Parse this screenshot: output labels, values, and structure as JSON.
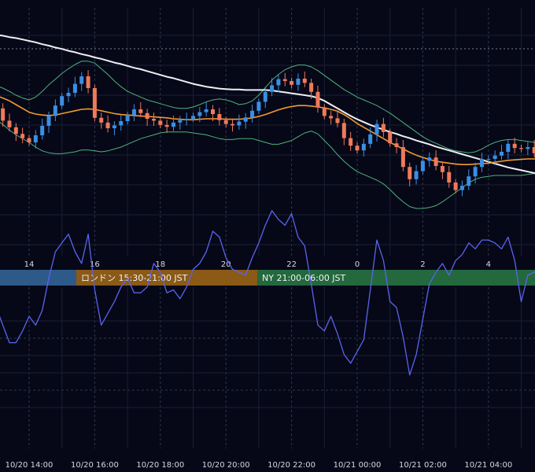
{
  "colors": {
    "background": "#060818",
    "grid": "#1a1f33",
    "grid_dashed": "#303650",
    "axis_text": "#d6d8e0",
    "candle_up": "#3b8fe3",
    "candle_down": "#ef7a5a",
    "ma_slow": "#eef0f4",
    "ma_fast": "#f29a2e",
    "bollinger": "#4fb27a",
    "oscillator": "#5a63ee",
    "session_tokyo": "#2e5a8a",
    "session_london": "#8a5a16",
    "session_ny": "#24683e"
  },
  "sessions": [
    {
      "label": "",
      "color": "#2e5a8a"
    },
    {
      "label": "ロンドン 15:30-21:00 JST",
      "color": "#8a5a16"
    },
    {
      "label": "NY 21:00-06:00 JST",
      "color": "#24683e"
    }
  ],
  "chart_data": [
    {
      "type": "candlestick",
      "x_tick_labels": [
        "14",
        "16",
        "18",
        "20",
        "22",
        "0",
        "2",
        "4"
      ],
      "x": [
        -2.0,
        -1.8,
        -1.6,
        -1.4,
        -1.2,
        -1.0,
        -0.8,
        -0.6,
        -0.4,
        -0.2,
        0.0,
        0.2,
        0.4,
        0.6,
        0.8,
        1.0,
        1.2,
        1.4,
        1.6,
        1.8,
        2.0,
        2.2,
        2.4,
        2.6,
        2.8,
        3.0,
        3.2,
        3.4,
        3.6,
        3.8,
        4.0,
        4.2,
        4.4,
        4.6,
        4.8,
        5.0,
        5.2,
        5.4,
        5.6,
        5.8,
        6.0,
        6.2,
        6.4,
        6.6,
        6.8,
        7.0,
        7.2,
        7.4,
        7.6,
        7.8,
        8.0,
        8.2,
        8.4,
        8.6,
        8.8,
        9.0,
        9.2,
        9.4,
        9.6,
        9.8,
        10.0,
        10.2,
        10.4,
        10.6,
        10.8,
        11.0,
        11.2,
        11.4,
        11.6,
        11.8,
        12.0,
        12.2,
        12.4,
        12.6,
        12.8,
        13.0,
        13.2,
        13.4,
        13.6,
        13.8,
        14.0,
        14.2,
        14.4,
        14.6,
        14.8,
        15.0,
        15.2,
        15.4,
        15.6,
        15.8,
        16.0,
        16.2,
        16.4,
        16.6,
        16.8,
        17.0,
        17.2,
        17.4,
        17.6,
        17.8,
        18.0
      ],
      "close": [
        1.62,
        1.58,
        1.35,
        1.48,
        1.3,
        1.12,
        0.86,
        0.72,
        0.58,
        0.49,
        0.4,
        0.55,
        0.75,
        0.96,
        1.18,
        1.38,
        1.45,
        1.64,
        1.8,
        1.55,
        0.92,
        0.82,
        0.7,
        0.76,
        0.85,
        0.98,
        1.1,
        1.02,
        0.9,
        0.86,
        0.77,
        0.73,
        0.82,
        0.87,
        0.9,
        0.96,
        1.04,
        1.1,
        1.0,
        0.87,
        0.79,
        0.76,
        0.84,
        0.93,
        1.07,
        1.26,
        1.47,
        1.61,
        1.74,
        1.7,
        1.62,
        1.75,
        1.66,
        1.47,
        1.14,
        0.96,
        0.91,
        0.81,
        0.49,
        0.33,
        0.23,
        0.37,
        0.57,
        0.79,
        0.62,
        0.38,
        0.3,
        -0.12,
        -0.38,
        -0.21,
        0.01,
        0.08,
        -0.1,
        -0.23,
        -0.45,
        -0.61,
        -0.52,
        -0.32,
        -0.12,
        0.05,
        0.05,
        0.12,
        0.2,
        0.37,
        0.28,
        0.26,
        0.3,
        0.17,
        0.1,
        0.11,
        0.17,
        0.12,
        0.12,
        0.05,
        0.04,
        0.02,
        -0.07,
        0.09,
        -0.24,
        -0.13,
        0.04
      ],
      "ma_fast": [
        1.5,
        1.48,
        1.46,
        1.44,
        1.42,
        1.39,
        1.34,
        1.28,
        1.2,
        1.12,
        1.04,
        1.0,
        0.98,
        0.97,
        0.98,
        1.01,
        1.04,
        1.07,
        1.1,
        1.11,
        1.1,
        1.07,
        1.04,
        1.01,
        0.99,
        0.98,
        0.97,
        0.96,
        0.95,
        0.94,
        0.93,
        0.92,
        0.9,
        0.89,
        0.88,
        0.88,
        0.89,
        0.9,
        0.9,
        0.9,
        0.89,
        0.89,
        0.89,
        0.9,
        0.92,
        0.95,
        0.99,
        1.04,
        1.09,
        1.13,
        1.16,
        1.18,
        1.18,
        1.17,
        1.15,
        1.13,
        1.1,
        1.06,
        0.99,
        0.9,
        0.8,
        0.72,
        0.64,
        0.56,
        0.48,
        0.4,
        0.33,
        0.26,
        0.19,
        0.13,
        0.08,
        0.04,
        0.0,
        -0.02,
        -0.04,
        -0.06,
        -0.07,
        -0.07,
        -0.06,
        -0.05,
        -0.04,
        -0.02,
        0.0,
        0.02,
        0.03,
        0.04,
        0.05,
        0.05,
        0.05,
        0.05,
        0.05,
        0.05,
        0.05,
        0.05,
        0.04,
        0.04,
        0.03,
        0.03,
        0.02,
        0.02,
        0.02
      ],
      "ma_slow": [
        2.78,
        2.76,
        2.74,
        2.72,
        2.7,
        2.68,
        2.66,
        2.63,
        2.61,
        2.58,
        2.55,
        2.52,
        2.48,
        2.45,
        2.41,
        2.38,
        2.34,
        2.31,
        2.27,
        2.24,
        2.2,
        2.17,
        2.13,
        2.09,
        2.06,
        2.02,
        1.98,
        1.95,
        1.91,
        1.87,
        1.83,
        1.79,
        1.76,
        1.72,
        1.68,
        1.64,
        1.61,
        1.58,
        1.56,
        1.54,
        1.53,
        1.52,
        1.52,
        1.51,
        1.51,
        1.51,
        1.51,
        1.5,
        1.48,
        1.46,
        1.44,
        1.42,
        1.4,
        1.38,
        1.34,
        1.28,
        1.2,
        1.12,
        1.04,
        0.96,
        0.89,
        0.83,
        0.77,
        0.72,
        0.67,
        0.62,
        0.58,
        0.53,
        0.49,
        0.44,
        0.4,
        0.36,
        0.31,
        0.27,
        0.23,
        0.19,
        0.15,
        0.11,
        0.07,
        0.03,
        -0.01,
        -0.05,
        -0.09,
        -0.13,
        -0.16,
        -0.19,
        -0.22,
        -0.25,
        -0.28,
        -0.31,
        -0.33,
        -0.36,
        -0.38,
        -0.4,
        -0.43,
        -0.46,
        -0.48,
        -0.51,
        -0.54,
        -0.57,
        -0.6
      ],
      "bollinger_upper": [
        1.82,
        1.78,
        1.74,
        1.7,
        1.66,
        1.6,
        1.55,
        1.48,
        1.4,
        1.34,
        1.3,
        1.36,
        1.48,
        1.62,
        1.74,
        1.86,
        1.96,
        2.05,
        2.12,
        2.12,
        2.08,
        1.96,
        1.84,
        1.7,
        1.58,
        1.48,
        1.42,
        1.36,
        1.3,
        1.26,
        1.22,
        1.18,
        1.14,
        1.12,
        1.12,
        1.15,
        1.2,
        1.26,
        1.3,
        1.32,
        1.3,
        1.26,
        1.2,
        1.22,
        1.28,
        1.4,
        1.56,
        1.72,
        1.84,
        1.94,
        2.0,
        2.04,
        2.04,
        2.0,
        1.92,
        1.82,
        1.72,
        1.62,
        1.52,
        1.44,
        1.36,
        1.3,
        1.24,
        1.18,
        1.1,
        1.02,
        0.92,
        0.82,
        0.72,
        0.62,
        0.52,
        0.44,
        0.38,
        0.32,
        0.26,
        0.22,
        0.2,
        0.18,
        0.2,
        0.26,
        0.34,
        0.4,
        0.44,
        0.46,
        0.46,
        0.44,
        0.42,
        0.4,
        0.38,
        0.36,
        0.34,
        0.3,
        0.26,
        0.24,
        0.22,
        0.22,
        0.22,
        0.24,
        0.24,
        0.24,
        0.24
      ],
      "bollinger_lower": [
        1.26,
        1.22,
        1.16,
        1.08,
        0.98,
        0.88,
        0.78,
        0.66,
        0.56,
        0.48,
        0.4,
        0.3,
        0.22,
        0.18,
        0.16,
        0.16,
        0.18,
        0.2,
        0.24,
        0.24,
        0.22,
        0.2,
        0.22,
        0.26,
        0.3,
        0.36,
        0.42,
        0.48,
        0.52,
        0.56,
        0.6,
        0.62,
        0.62,
        0.62,
        0.62,
        0.6,
        0.58,
        0.56,
        0.52,
        0.48,
        0.46,
        0.46,
        0.48,
        0.48,
        0.48,
        0.44,
        0.4,
        0.36,
        0.36,
        0.4,
        0.44,
        0.52,
        0.6,
        0.64,
        0.58,
        0.44,
        0.3,
        0.14,
        0.0,
        -0.12,
        -0.22,
        -0.28,
        -0.34,
        -0.4,
        -0.48,
        -0.6,
        -0.74,
        -0.86,
        -0.96,
        -1.0,
        -1.0,
        -0.98,
        -0.94,
        -0.86,
        -0.76,
        -0.66,
        -0.56,
        -0.46,
        -0.38,
        -0.34,
        -0.32,
        -0.3,
        -0.3,
        -0.3,
        -0.3,
        -0.3,
        -0.28,
        -0.26,
        -0.24,
        -0.22,
        -0.2,
        -0.2,
        -0.2,
        -0.18,
        -0.16,
        -0.14,
        -0.14,
        -0.14,
        -0.14,
        -0.14,
        -0.14
      ]
    },
    {
      "type": "line",
      "x_tick_labels": [
        "10/20 14:00",
        "10/20 16:00",
        "10/20 18:00",
        "10/20 20:00",
        "10/20 22:00",
        "10/21 00:00",
        "10/21 02:00",
        "10/21 04:00"
      ],
      "x": [
        -2.0,
        -1.8,
        -1.6,
        -1.4,
        -1.2,
        -1.0,
        -0.8,
        -0.6,
        -0.4,
        -0.2,
        0.0,
        0.2,
        0.4,
        0.6,
        0.8,
        1.0,
        1.2,
        1.4,
        1.6,
        1.8,
        2.0,
        2.2,
        2.4,
        2.6,
        2.8,
        3.0,
        3.2,
        3.4,
        3.6,
        3.8,
        4.0,
        4.2,
        4.4,
        4.6,
        4.8,
        5.0,
        5.2,
        5.4,
        5.6,
        5.8,
        6.0,
        6.2,
        6.4,
        6.6,
        6.8,
        7.0,
        7.2,
        7.4,
        7.6,
        7.8,
        8.0,
        8.2,
        8.4,
        8.6,
        8.8,
        9.0,
        9.2,
        9.4,
        9.6,
        9.8,
        10.0,
        10.2,
        10.4,
        10.6,
        10.8,
        11.0,
        11.2,
        11.4,
        11.6,
        11.8,
        12.0,
        12.2,
        12.4,
        12.6,
        12.8,
        13.0,
        13.2,
        13.4,
        13.6,
        13.8,
        14.0,
        14.2,
        14.4,
        14.6,
        14.8,
        15.0,
        15.2,
        15.4,
        15.6,
        15.8,
        16.0,
        16.2,
        16.4,
        16.6,
        16.8,
        17.0,
        17.2,
        17.4,
        17.6,
        17.8,
        18.0
      ],
      "y": [
        60,
        58,
        54,
        49,
        48,
        44,
        38,
        32,
        32,
        36,
        41,
        38,
        43,
        54,
        63,
        66,
        69,
        63,
        59,
        69,
        50,
        38,
        42,
        46,
        51,
        54,
        49,
        49,
        51,
        59,
        56,
        49,
        50,
        47,
        51,
        57,
        59,
        63,
        70,
        68,
        61,
        57,
        56,
        55,
        61,
        66,
        72,
        77,
        74,
        72,
        76,
        68,
        65,
        52,
        38,
        36,
        41,
        35,
        28,
        25,
        29,
        33,
        50,
        67,
        60,
        46,
        44,
        34,
        21,
        28,
        40,
        52,
        56,
        59,
        55,
        60,
        62,
        66,
        64,
        67,
        67,
        66,
        64,
        68,
        60,
        46,
        55,
        56,
        58,
        55,
        51,
        57,
        56,
        55,
        53,
        52,
        52,
        57,
        40,
        48,
        60
      ]
    }
  ]
}
